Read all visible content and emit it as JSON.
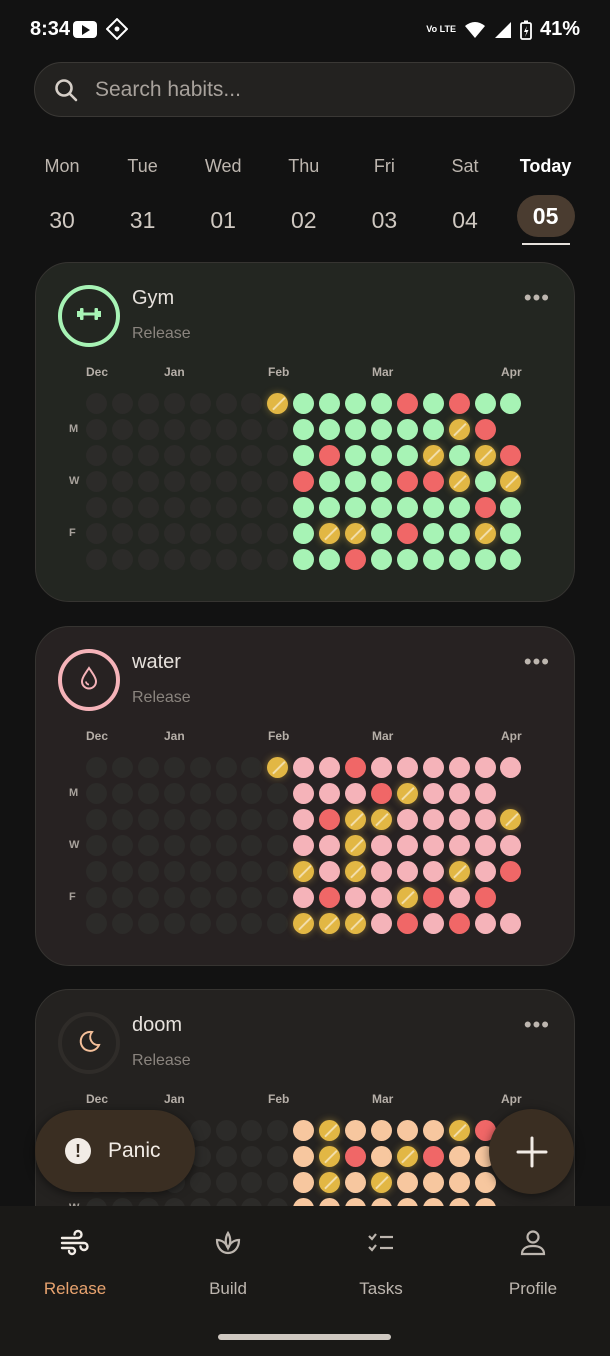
{
  "status_bar": {
    "time": "8:34",
    "battery": "41%",
    "network": "Vo LTE"
  },
  "search": {
    "placeholder": "Search habits..."
  },
  "days": [
    {
      "name": "Mon",
      "date": "30"
    },
    {
      "name": "Tue",
      "date": "31"
    },
    {
      "name": "Wed",
      "date": "01"
    },
    {
      "name": "Thu",
      "date": "02"
    },
    {
      "name": "Fri",
      "date": "03"
    },
    {
      "name": "Sat",
      "date": "04"
    },
    {
      "name": "Today",
      "date": "05",
      "today": true
    }
  ],
  "months": [
    "Dec",
    "Jan",
    "Feb",
    "Mar",
    "Apr"
  ],
  "weekday_labels": [
    "M",
    "W",
    "F"
  ],
  "legend_colors": {
    "empty": "#2c2b29",
    "skip": "#e2b744",
    "missed": "#f06767"
  },
  "habits": [
    {
      "title": "Gym",
      "subtitle": "Release",
      "icon": "dumbbell-icon",
      "accent": "#a7f3b5",
      "card_bg": "#232621",
      "done_color": "#a7f3b5",
      "grid": [
        "......._YYYYRYRYY",
        "........YYYYYY_R.",
        "........YRYYY_Y_R",
        "........RYYYRR_Y_",
        "........YYYYYYYRY",
        "........Y__YRYY_Y",
        "........YYRYYYYYY"
      ]
    },
    {
      "title": "water",
      "subtitle": "Release",
      "icon": "droplet-icon",
      "accent": "#f5b3b9",
      "card_bg": "#272222",
      "done_color": "#f5b3b9",
      "grid": [
        "......._YYRYYYYYY",
        "........YYYR_YYY.",
        "........YR__YYYY_",
        "........YY_YYYYYY",
        "........_Y_YYY_YR",
        "........YRYY_RYR.",
        "........___YRYRYY"
      ]
    },
    {
      "title": "doom",
      "subtitle": "Release",
      "icon": "moon-icon",
      "accent": "#f5c09a",
      "card_bg": "#242220",
      "done_color": "#f7c79f",
      "grid": [
        "........Y_YYYY_R.",
        "........Y_RY_RYY.",
        "........Y_Y_YYYY.",
        "........YYYYYYYY."
      ]
    }
  ],
  "fab": {
    "panic_label": "Panic"
  },
  "nav": [
    {
      "label": "Release",
      "icon": "wind-icon",
      "active": true
    },
    {
      "label": "Build",
      "icon": "sprout-icon",
      "active": false
    },
    {
      "label": "Tasks",
      "icon": "checklist-icon",
      "active": false
    },
    {
      "label": "Profile",
      "icon": "person-icon",
      "active": false
    }
  ]
}
